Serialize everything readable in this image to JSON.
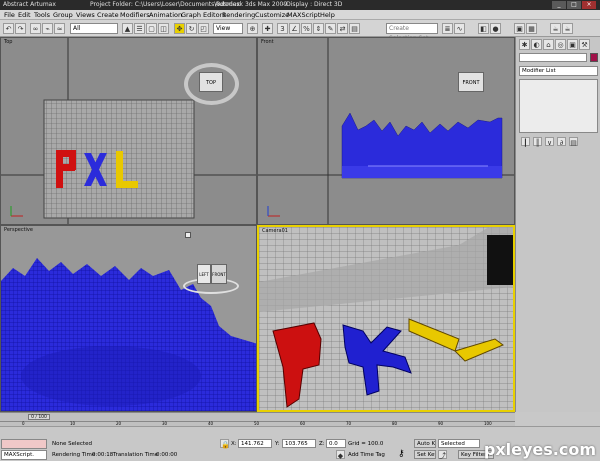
{
  "titlebar": {
    "left": "Abstract Artumax",
    "path": "Project Folder: C:\\Users\\Loser\\Documents\\3dsmax",
    "app": "Autodesk 3ds Max 2009",
    "display": "- Display : Direct 3D"
  },
  "menu": [
    "File",
    "Edit",
    "Tools",
    "Group",
    "Views",
    "Create",
    "Modifiers",
    "Animation",
    "Graph Editors",
    "Rendering",
    "Customize",
    "MAXScript",
    "Help"
  ],
  "toolbar": {
    "selection_filter": "All",
    "ref_coord": "View",
    "named_selection": "Create Selection Set"
  },
  "viewports": {
    "top": {
      "label": "Top",
      "cube": "TOP"
    },
    "front": {
      "label": "Front",
      "cube": "FRONT"
    },
    "perspective": {
      "label": "Perspective",
      "cube_left": "LEFT",
      "cube_front": "FRONT"
    },
    "camera": {
      "label": "Camera01"
    }
  },
  "command_panel": {
    "modifier_list": "Modifier List"
  },
  "timeline": {
    "frame": "0 / 100",
    "ticks": [
      "0",
      "10",
      "20",
      "30",
      "40",
      "50",
      "60",
      "70",
      "80",
      "90",
      "100"
    ]
  },
  "status": {
    "maxscript": "MAXScript.",
    "selected": "None Selected",
    "render_time_label": "Rendering Time",
    "render_time": "0:00:18",
    "translation_label": "Translation Time",
    "translation": "0:00:00",
    "x_label": "X:",
    "x": "141.762",
    "y_label": "Y:",
    "y": "103.765",
    "z_label": "Z:",
    "z": "0.0",
    "grid": "Grid = 100.0",
    "add_time_tag": "Add Time Tag",
    "auto_key": "Auto Key",
    "set_key": "Set Key",
    "key_selected": "Selected",
    "key_filters": "Key Filters..."
  },
  "watermark": "pxleyes.com",
  "colors": {
    "blue": "#2b2bdb",
    "red": "#d01010",
    "yellow": "#e8c800",
    "accent": "#e8d000"
  }
}
